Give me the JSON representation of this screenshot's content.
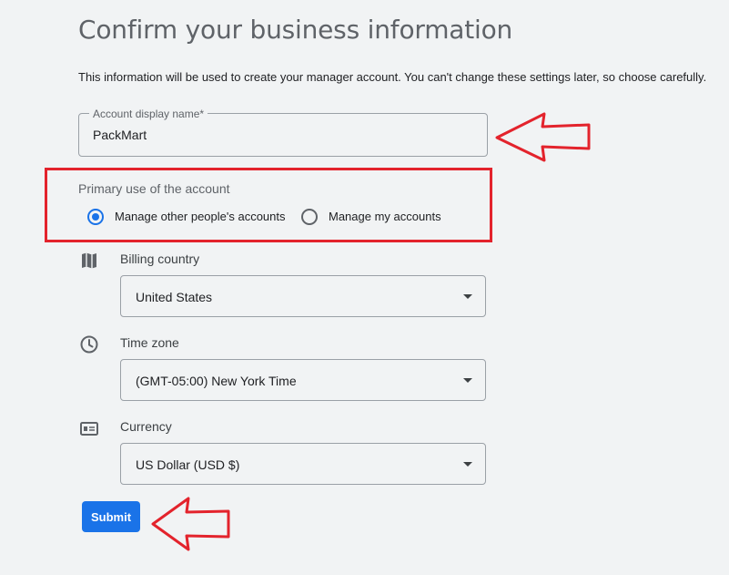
{
  "page": {
    "title": "Confirm your business information",
    "description": "This information will be used to create your manager account. You can't change these settings later, so choose carefully."
  },
  "display_name": {
    "label": "Account display name*",
    "value": "PackMart"
  },
  "primary_use": {
    "label": "Primary use of the account",
    "options": [
      {
        "label": "Manage other people's accounts",
        "selected": true
      },
      {
        "label": "Manage my accounts",
        "selected": false
      }
    ]
  },
  "billing_country": {
    "label": "Billing country",
    "value": "United States",
    "icon": "map-icon"
  },
  "time_zone": {
    "label": "Time zone",
    "value": "(GMT-05:00) New York Time",
    "icon": "clock-icon"
  },
  "currency": {
    "label": "Currency",
    "value": "US Dollar (USD $)",
    "icon": "currency-icon"
  },
  "submit": {
    "label": "Submit"
  },
  "colors": {
    "accent": "#1a73e8",
    "annotation": "#e3232c",
    "background": "#f1f3f4"
  }
}
